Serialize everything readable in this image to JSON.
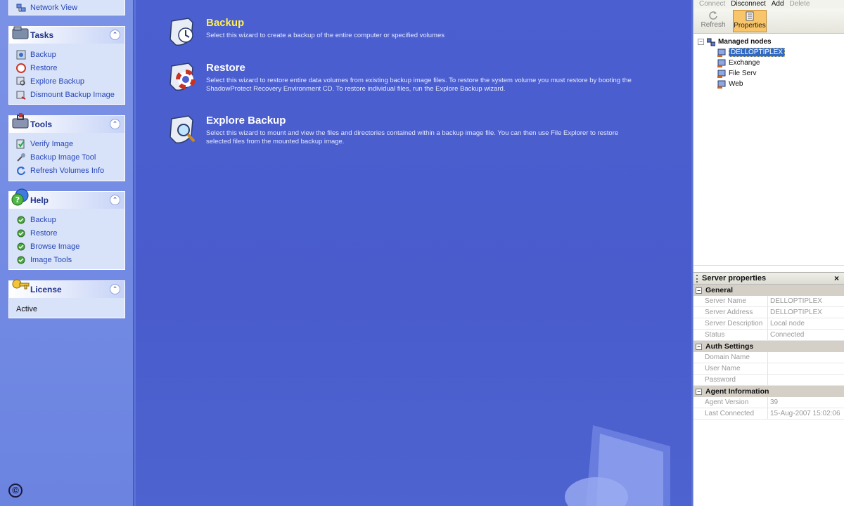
{
  "sidebar": {
    "top_link": "Network View",
    "tasks": {
      "title": "Tasks",
      "items": [
        "Backup",
        "Restore",
        "Explore Backup",
        "Dismount Backup Image"
      ]
    },
    "tools": {
      "title": "Tools",
      "items": [
        "Verify Image",
        "Backup Image Tool",
        "Refresh Volumes Info"
      ]
    },
    "help": {
      "title": "Help",
      "items": [
        "Backup",
        "Restore",
        "Browse Image",
        "Image Tools"
      ]
    },
    "license": {
      "title": "License",
      "status": "Active"
    },
    "copyright_symbol": "©"
  },
  "main": {
    "wizards": [
      {
        "title": "Backup",
        "description": "Select this wizard to create a backup of the entire computer or specified volumes"
      },
      {
        "title": "Restore",
        "description": "Select this wizard to restore entire data volumes from existing backup image files. To restore the system volume you must restore by booting the ShadowProtect Recovery Environment CD. To restore individual files, run the Explore Backup wizard."
      },
      {
        "title": "Explore Backup",
        "description": "Select this wizard to mount and view the files and directories contained within a backup image file. You can then use File Explorer to restore selected files from the mounted backup image."
      }
    ]
  },
  "right_panel": {
    "menu": [
      "Connect",
      "Disconnect",
      "Add",
      "Delete"
    ],
    "toolbar": {
      "refresh_label": "Refresh",
      "properties_label": "Properties"
    },
    "tree": {
      "root": "Managed nodes",
      "nodes": [
        "DELLOPTIPLEX",
        "Exchange",
        "File Serv",
        "Web"
      ],
      "selected": "DELLOPTIPLEX"
    },
    "properties": {
      "title": "Server properties",
      "close_symbol": "×",
      "categories": [
        {
          "name": "General",
          "rows": [
            {
              "key": "Server Name",
              "value": "DELLOPTIPLEX"
            },
            {
              "key": "Server Address",
              "value": "DELLOPTIPLEX"
            },
            {
              "key": "Server Description",
              "value": "Local node"
            },
            {
              "key": "Status",
              "value": "Connected"
            }
          ]
        },
        {
          "name": "Auth Settings",
          "rows": [
            {
              "key": "Domain Name",
              "value": ""
            },
            {
              "key": "User Name",
              "value": ""
            },
            {
              "key": "Password",
              "value": ""
            }
          ]
        },
        {
          "name": "Agent Information",
          "rows": [
            {
              "key": "Agent Version",
              "value": "39"
            },
            {
              "key": "Last Connected",
              "value": "15-Aug-2007 15:02:06"
            }
          ]
        }
      ]
    }
  },
  "colors": {
    "sidebar_bg": "#6b84e0",
    "main_bg": "#4b5fd0",
    "active_title": "#ffee55",
    "link": "#2747b8",
    "selection": "#316ac5"
  }
}
